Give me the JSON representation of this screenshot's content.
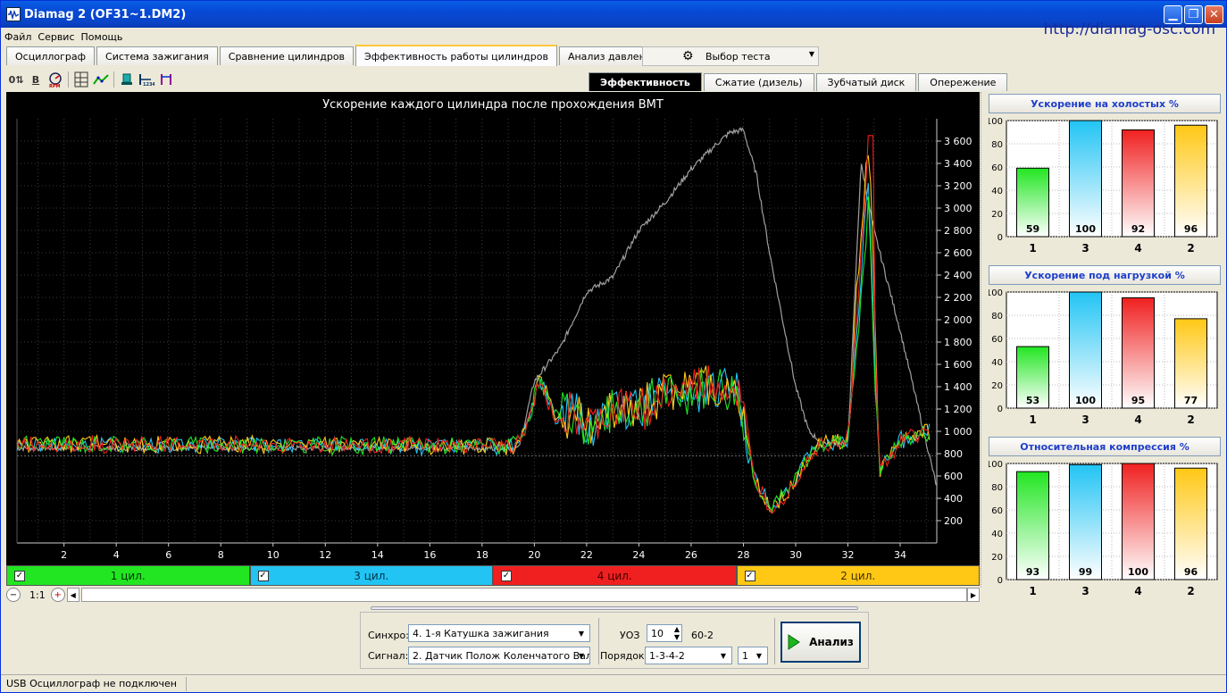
{
  "window": {
    "title": "Diamag 2 (OF31~1.DM2)"
  },
  "menu": [
    "Файл",
    "Сервис",
    "Помощь"
  ],
  "url": "http://diamag-osc.com",
  "tabs": [
    "Осциллограф",
    "Система зажигания",
    "Сравнение цилиндров",
    "Эффективность работы цилиндров",
    "Анализ давления в цилиндре"
  ],
  "active_tab": 3,
  "test_select": "Выбор теста",
  "subtabs": [
    "Эффективность",
    "Сжатие (дизель)",
    "Зубчатый диск",
    "Опережение"
  ],
  "active_subtab": 0,
  "toolbar_icons": [
    "zero-offset-icon",
    "bold-b-icon",
    "rpm-icon",
    "table-icon",
    "trend-icon",
    "cylinder-icon",
    "order-1234-icon",
    "marker-icon"
  ],
  "channels": [
    {
      "label": "1 цил.",
      "color": "#22E622",
      "text_color": "#003300"
    },
    {
      "label": "3 цил.",
      "color": "#22C4F4",
      "text_color": "#003344"
    },
    {
      "label": "4 цил.",
      "color": "#F02020",
      "text_color": "#400000"
    },
    {
      "label": "2 цил.",
      "color": "#FFC814",
      "text_color": "#403000"
    }
  ],
  "zoom_label": "1:1",
  "chart_data": {
    "type": "line",
    "title": "Ускорение каждого цилиндра после прохождения ВМТ",
    "x_ticks": [
      2,
      4,
      6,
      8,
      10,
      12,
      14,
      16,
      18,
      20,
      22,
      24,
      26,
      28,
      30,
      32,
      34
    ],
    "y_ticks": [
      200,
      400,
      600,
      800,
      1000,
      1200,
      1400,
      1600,
      1800,
      2000,
      2200,
      2400,
      2600,
      2800,
      3000,
      3200,
      3400,
      3600
    ],
    "y_tick_labels": [
      "200",
      "400",
      "600",
      "800",
      "1 000",
      "1 200",
      "1 400",
      "1 600",
      "1 800",
      "2 000",
      "2 200",
      "2 400",
      "2 600",
      "2 800",
      "3 000",
      "3 200",
      "3 400",
      "3 600"
    ],
    "xlim": [
      0.2,
      35.4
    ],
    "ylim": [
      0,
      3800
    ],
    "rpm_series": {
      "color": "#A0A0A0",
      "x": [
        0.2,
        19.4,
        20,
        20.5,
        21,
        22,
        23,
        24,
        25,
        26,
        27,
        27.5,
        28,
        28.5,
        29,
        29.5,
        30,
        30.5,
        31,
        32,
        32.5,
        33,
        34,
        35,
        35.4
      ],
      "y": [
        850,
        850,
        1450,
        1600,
        1750,
        2250,
        2380,
        2800,
        3050,
        3350,
        3580,
        3680,
        3700,
        3300,
        2600,
        2000,
        1400,
        1000,
        900,
        900,
        3400,
        2800,
        1900,
        900,
        500
      ]
    },
    "cylinder_envelope": {
      "x": [
        0.2,
        19.2,
        19.7,
        20.2,
        20.8,
        21.5,
        22,
        23,
        24,
        25,
        26,
        27,
        27.8,
        28.4,
        29,
        29.7,
        30.5,
        31,
        32,
        32.4,
        32.8,
        33.2,
        33.6,
        34,
        35.2
      ],
      "y": [
        890,
        870,
        1000,
        1480,
        1120,
        1150,
        1020,
        1180,
        1220,
        1320,
        1380,
        1420,
        1350,
        600,
        320,
        450,
        780,
        900,
        920,
        2200,
        3350,
        650,
        780,
        920,
        1000
      ]
    },
    "noise_amplitude": 90,
    "active_zone_amplitude": 240
  },
  "panels": [
    {
      "title": "Ускорение на холостых %",
      "categories": [
        "1",
        "3",
        "4",
        "2"
      ],
      "values": [
        59,
        100,
        92,
        96
      ],
      "ylim": [
        0,
        100
      ],
      "y_ticks": [
        0,
        20,
        40,
        60,
        80,
        100
      ]
    },
    {
      "title": "Ускорение под нагрузкой %",
      "categories": [
        "1",
        "3",
        "4",
        "2"
      ],
      "values": [
        53,
        100,
        95,
        77
      ],
      "ylim": [
        0,
        100
      ],
      "y_ticks": [
        0,
        20,
        40,
        60,
        80,
        100
      ]
    },
    {
      "title": "Относительная компрессия %",
      "categories": [
        "1",
        "3",
        "4",
        "2"
      ],
      "values": [
        93,
        99,
        100,
        96
      ],
      "ylim": [
        0,
        100
      ],
      "y_ticks": [
        0,
        20,
        40,
        60,
        80,
        100
      ]
    }
  ],
  "bar_colors": [
    "#22E622",
    "#22C4F4",
    "#F02020",
    "#FFC814"
  ],
  "bottom": {
    "sync_label": "Синхро:",
    "sync_value": "4.  1-я Катушка зажигания",
    "signal_label": "Сигнал:",
    "signal_value": "2.  Датчик Полож Коленчатого Вал",
    "uoz_label": "УОЗ",
    "uoz_value": "10",
    "teeth": "60-2",
    "order_label": "Порядок",
    "order_value": "1-3-4-2",
    "order_index": "1",
    "analyze_label": "Анализ"
  },
  "status": "USB Осциллограф не подключен"
}
